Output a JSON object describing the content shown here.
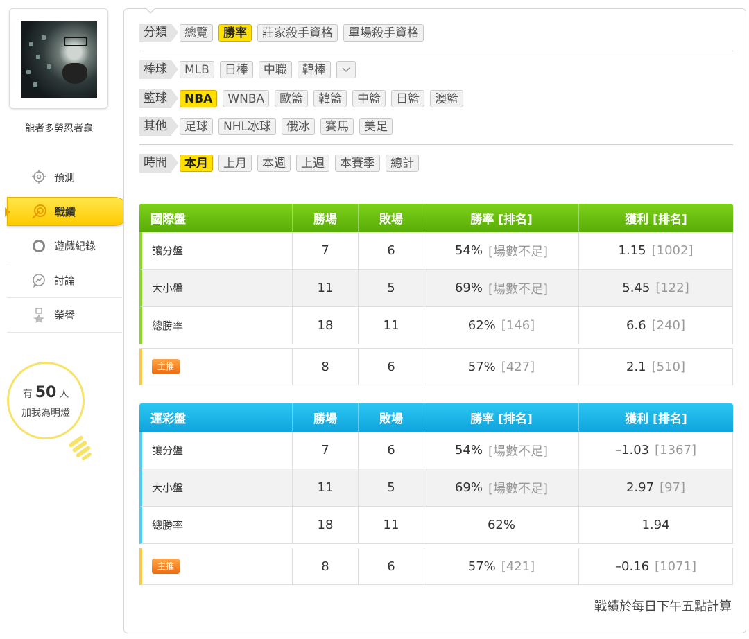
{
  "sidebar": {
    "username": "能者多勞忍者龜",
    "menu": [
      {
        "label": "預測"
      },
      {
        "label": "戰績"
      },
      {
        "label": "遊戲紀錄"
      },
      {
        "label": "討論"
      },
      {
        "label": "榮譽"
      }
    ],
    "fans": {
      "prefix": "有",
      "count": "50",
      "suffix": "人",
      "line2": "加我為明燈"
    }
  },
  "filters": {
    "category": {
      "label": "分類",
      "options": [
        "總覽",
        "勝率",
        "莊家殺手資格",
        "單場殺手資格"
      ],
      "selected": "勝率"
    },
    "baseball": {
      "label": "棒球",
      "options": [
        "MLB",
        "日棒",
        "中職",
        "韓棒"
      ],
      "selected": ""
    },
    "basketball": {
      "label": "籃球",
      "options": [
        "NBA",
        "WNBA",
        "歐籃",
        "韓籃",
        "中籃",
        "日籃",
        "澳籃"
      ],
      "selected": "NBA"
    },
    "other": {
      "label": "其他",
      "options": [
        "足球",
        "NHL冰球",
        "俄冰",
        "賽馬",
        "美足"
      ],
      "selected": ""
    },
    "time": {
      "label": "時間",
      "options": [
        "本月",
        "上月",
        "本週",
        "上週",
        "本賽季",
        "總計"
      ],
      "selected": "本月"
    }
  },
  "tables": [
    {
      "title": "國際盤",
      "headers": [
        "勝場",
        "敗場",
        "勝率 [排名]",
        "獲利 [排名]"
      ],
      "rows": [
        {
          "label": "讓分盤",
          "wins": "7",
          "losses": "6",
          "rate": "54%",
          "rate_rank": "[場數不足]",
          "profit": "1.15",
          "profit_rank": "[1002]"
        },
        {
          "label": "大小盤",
          "wins": "11",
          "losses": "5",
          "rate": "69%",
          "rate_rank": "[場數不足]",
          "profit": "5.45",
          "profit_rank": "[122]"
        },
        {
          "label": "總勝率",
          "wins": "18",
          "losses": "11",
          "rate": "62%",
          "rate_rank": "[146]",
          "profit": "6.6",
          "profit_rank": "[240]"
        }
      ],
      "star_row": {
        "badge": "主推",
        "wins": "8",
        "losses": "6",
        "rate": "57%",
        "rate_rank": "[427]",
        "profit": "2.1",
        "profit_rank": "[510]"
      }
    },
    {
      "title": "運彩盤",
      "headers": [
        "勝場",
        "敗場",
        "勝率 [排名]",
        "獲利 [排名]"
      ],
      "rows": [
        {
          "label": "讓分盤",
          "wins": "7",
          "losses": "6",
          "rate": "54%",
          "rate_rank": "[場數不足]",
          "profit": "–1.03",
          "profit_rank": "[1367]"
        },
        {
          "label": "大小盤",
          "wins": "11",
          "losses": "5",
          "rate": "69%",
          "rate_rank": "[場數不足]",
          "profit": "2.97",
          "profit_rank": "[97]"
        },
        {
          "label": "總勝率",
          "wins": "18",
          "losses": "11",
          "rate": "62%",
          "rate_rank": "",
          "profit": "1.94",
          "profit_rank": ""
        }
      ],
      "star_row": {
        "badge": "主推",
        "wins": "8",
        "losses": "6",
        "rate": "57%",
        "rate_rank": "[421]",
        "profit": "–0.16",
        "profit_rank": "[1071]"
      }
    }
  ],
  "footnote": "戰績於每日下午五點計算",
  "colors": {
    "accent_yellow": "#ffe000",
    "intl_header": "#6cc010",
    "lottery_header": "#1cb2e8",
    "badge_orange": "#f47b20"
  }
}
